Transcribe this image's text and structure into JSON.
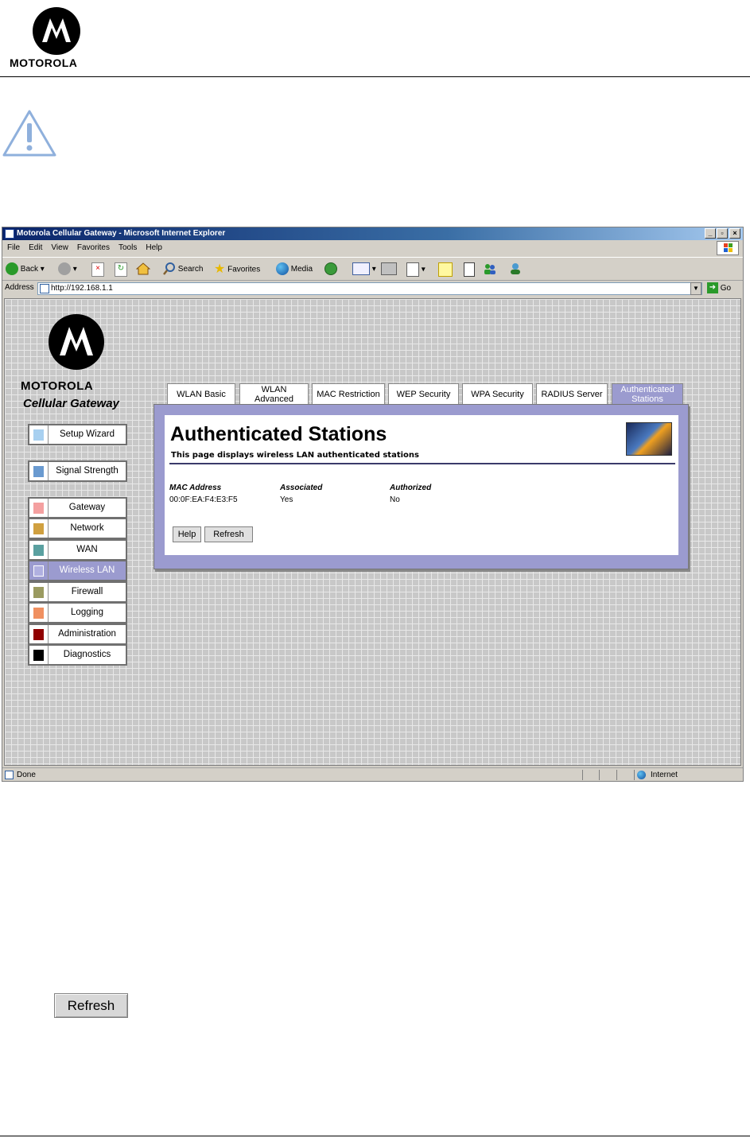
{
  "document": {
    "logo_text": "MOTOROLA"
  },
  "browser": {
    "title": "Motorola Cellular Gateway - Microsoft Internet Explorer",
    "menu": [
      "File",
      "Edit",
      "View",
      "Favorites",
      "Tools",
      "Help"
    ],
    "toolbar": {
      "back": "Back",
      "search": "Search",
      "favorites": "Favorites",
      "media": "Media"
    },
    "address_label": "Address",
    "address_value": "http://192.168.1.1",
    "go_label": "Go",
    "status_left": "Done",
    "status_zone": "Internet"
  },
  "page": {
    "logo_text": "MOTOROLA",
    "product": "Cellular Gateway",
    "nav": [
      {
        "label": "Setup Wizard",
        "color": "#a8d0f0"
      },
      {
        "label": "Signal Strength",
        "color": "#6a9ad0"
      },
      {
        "label": "Gateway",
        "color": "#f4a0a0"
      },
      {
        "label": "Network",
        "color": "#d0a040"
      },
      {
        "label": "WAN",
        "color": "#5aa0a0"
      },
      {
        "label": "Wireless LAN",
        "color": "#b0b0e0"
      },
      {
        "label": "Firewall",
        "color": "#9a9a60"
      },
      {
        "label": "Logging",
        "color": "#f09060"
      },
      {
        "label": "Administration",
        "color": "#900000"
      },
      {
        "label": "Diagnostics",
        "color": "#000000"
      }
    ],
    "tabs": [
      {
        "label": "WLAN Basic"
      },
      {
        "label": "WLAN\nAdvanced"
      },
      {
        "label": "MAC Restriction"
      },
      {
        "label": "WEP Security"
      },
      {
        "label": "WPA Security"
      },
      {
        "label": "RADIUS Server"
      },
      {
        "label": "Authenticated\nStations"
      }
    ],
    "panel": {
      "title": "Authenticated Stations",
      "subtitle": "This page displays wireless LAN authenticated stations",
      "columns": [
        "MAC Address",
        "Associated",
        "Authorized"
      ],
      "rows": [
        [
          "00:0F:EA:F4:E3:F5",
          "Yes",
          "No"
        ]
      ],
      "help_button": "Help",
      "refresh_button": "Refresh"
    }
  },
  "big_refresh_label": "Refresh",
  "colors": {
    "accent": "#9b9bcf",
    "titlebar": "#0a246a"
  }
}
